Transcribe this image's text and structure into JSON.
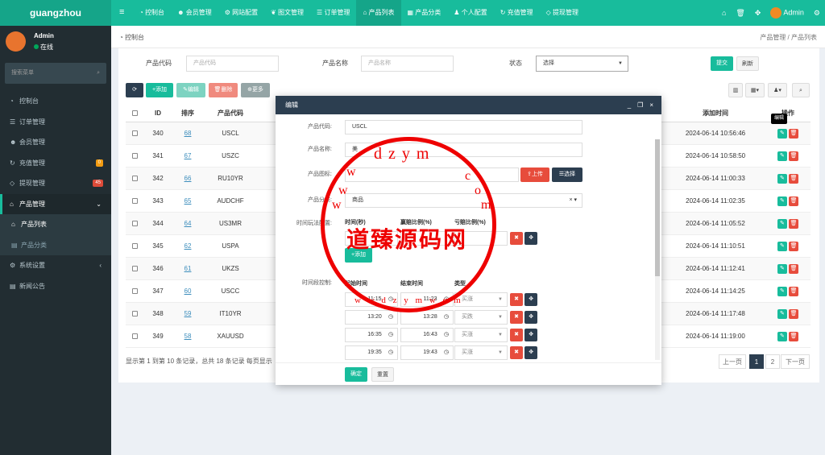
{
  "app": {
    "logo": "guangzhou"
  },
  "topnav": [
    {
      "icon": "dashboard-icon",
      "label": "控制台"
    },
    {
      "icon": "users-icon",
      "label": "会员管理"
    },
    {
      "icon": "gear-icon",
      "label": "网站配置"
    },
    {
      "icon": "leaf-icon",
      "label": "图文管理"
    },
    {
      "icon": "list-icon",
      "label": "订单管理"
    },
    {
      "icon": "bank-icon",
      "label": "产品列表"
    },
    {
      "icon": "table-icon",
      "label": "产品分类"
    },
    {
      "icon": "user-icon",
      "label": "个人配置"
    },
    {
      "icon": "recharge-icon",
      "label": "充值管理"
    },
    {
      "icon": "withdraw-icon",
      "label": "提现管理"
    }
  ],
  "topright": {
    "user": "Admin"
  },
  "sidebar": {
    "user_name": "Admin",
    "user_status": "在线",
    "search_placeholder": "搜索菜单",
    "items": [
      {
        "label": "控制台",
        "icon": "dashboard-icon"
      },
      {
        "label": "订单管理",
        "icon": "list-icon"
      },
      {
        "label": "会员管理",
        "icon": "users-icon"
      },
      {
        "label": "充值管理",
        "icon": "recharge-icon",
        "badge": "0",
        "badge_color": "#f39c12"
      },
      {
        "label": "提现管理",
        "icon": "withdraw-icon",
        "badge": "45",
        "badge_color": "#dd4b39"
      },
      {
        "label": "产品管理",
        "icon": "bank-icon"
      },
      {
        "label": "产品列表",
        "icon": "bank-icon"
      },
      {
        "label": "产品分类",
        "icon": "table-icon"
      },
      {
        "label": "系统设置",
        "icon": "gears-icon"
      },
      {
        "label": "新闻公告",
        "icon": "news-icon"
      }
    ]
  },
  "breadcrumb": {
    "left": "控制台",
    "right": "产品管理 / 产品列表"
  },
  "filters": {
    "code_label": "产品代码",
    "code_placeholder": "产品代码",
    "name_label": "产品名称",
    "name_placeholder": "产品名称",
    "status_label": "状态",
    "status_value": "选择",
    "submit": "提交",
    "reset": "刷新"
  },
  "toolbar": {
    "refresh": "⟳",
    "add": "添加",
    "edit": "编辑",
    "delete": "删除",
    "more": "更多"
  },
  "table": {
    "headers": {
      "id": "ID",
      "sort": "排序",
      "code": "产品代码",
      "added": "添加时间",
      "ops": "操作"
    },
    "rows": [
      {
        "id": "340",
        "sort": "68",
        "code": "USCL",
        "added": "2024-06-14 10:56:46"
      },
      {
        "id": "341",
        "sort": "67",
        "code": "USZC",
        "added": "2024-06-14 10:58:50"
      },
      {
        "id": "342",
        "sort": "66",
        "code": "RU10YR",
        "added": "2024-06-14 11:00:33"
      },
      {
        "id": "343",
        "sort": "65",
        "code": "AUDCHF",
        "added": "2024-06-14 11:02:35"
      },
      {
        "id": "344",
        "sort": "64",
        "code": "US3MR",
        "added": "2024-06-14 11:05:52"
      },
      {
        "id": "345",
        "sort": "62",
        "code": "USPA",
        "added": "2024-06-14 11:10:51"
      },
      {
        "id": "346",
        "sort": "61",
        "code": "UKZS",
        "added": "2024-06-14 11:12:41"
      },
      {
        "id": "347",
        "sort": "60",
        "code": "USCC",
        "added": "2024-06-14 11:14:25"
      },
      {
        "id": "348",
        "sort": "59",
        "code": "IT10YR",
        "added": "2024-06-14 11:17:48"
      },
      {
        "id": "349",
        "sort": "58",
        "code": "XAUUSD",
        "added": "2024-06-14 11:19:00"
      }
    ]
  },
  "tooltip": "编辑",
  "pagination": {
    "summary": "显示第 1 到第 10 条记录，总共 18 条记录 每页显示",
    "prev": "上一页",
    "p1": "1",
    "p2": "2",
    "next": "下一页"
  },
  "modal": {
    "title": "编辑",
    "code_label": "产品代码:",
    "code_value": "USCL",
    "name_label": "产品名称:",
    "name_value": "美",
    "icon_label": "产品图标:",
    "upload": "上传",
    "choose": "选择",
    "category_label": "产品分类:",
    "category_value": "商品",
    "time_play_label": "时间玩法配置:",
    "time_headers": {
      "time": "时间(秒)",
      "profit": "赢赔比例(%)",
      "loss": "亏赔比例(%)"
    },
    "add_btn": "添加",
    "timeslot_label": "时间段控制:",
    "slot_headers": {
      "start": "起始时间",
      "end": "结束时间",
      "type": "类型"
    },
    "slots": [
      {
        "start": "11:15",
        "end": "11:23",
        "type": "买涨"
      },
      {
        "start": "13:20",
        "end": "13:28",
        "type": "买跌"
      },
      {
        "start": "16:35",
        "end": "16:43",
        "type": "买涨"
      },
      {
        "start": "19:35",
        "end": "19:43",
        "type": "买涨"
      }
    ],
    "confirm": "确定",
    "reset": "重置"
  },
  "watermark": {
    "title": "道臻源码网",
    "letters_top": "dzym",
    "left_w1": "w",
    "left_w2": "w",
    "left_w3": "w",
    "right_c": "c",
    "right_o": "o",
    "right_m": "m",
    "bottom": "w w d z y m w c m"
  },
  "colors": {
    "primary": "#18bc9c",
    "dark": "#222d32",
    "danger": "#e74c3c",
    "modal_head": "#2c3e50",
    "stamp": "#e00000"
  }
}
